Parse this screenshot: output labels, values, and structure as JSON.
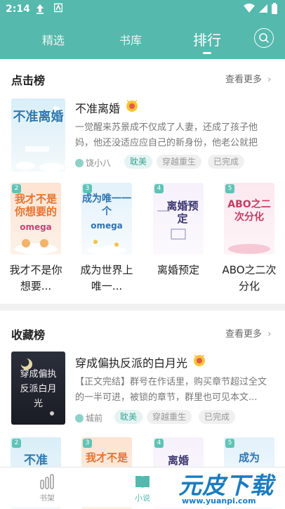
{
  "status": {
    "time": "2:14"
  },
  "nav": {
    "tabs": [
      {
        "label": "精选"
      },
      {
        "label": "书库"
      },
      {
        "label": "排行"
      }
    ]
  },
  "sections": [
    {
      "title": "点击榜",
      "more": "查看更多",
      "featured": {
        "title": "不准离婚",
        "desc": "一觉醒来苏景成不仅成了人妻，还成了孩子他妈，他还没适应应自己的新身份，他老公就把一...",
        "author": "饶小八",
        "tags": [
          "耽美",
          "穿越重生",
          "已完成"
        ],
        "cover_text": "不准离婚"
      },
      "grid": [
        {
          "rank": "2",
          "title": "我才不是你想要...",
          "cover_text": "我才不是你想要的",
          "cover_sub": "omega"
        },
        {
          "rank": "3",
          "title": "成为世界上唯一...",
          "cover_text": "成为唯一一个",
          "cover_sub": "omega"
        },
        {
          "rank": "4",
          "title": "离婚预定",
          "cover_text": "离婚预定",
          "cover_sub": ""
        },
        {
          "rank": "5",
          "title": "ABO之二次分化",
          "cover_text": "ABO之二次分化",
          "cover_sub": ""
        }
      ]
    },
    {
      "title": "收藏榜",
      "more": "查看更多",
      "featured": {
        "title": "穿成偏执反派的白月光",
        "desc": "【正文完结】群号在作话里，购买章节超过全文的一半可进，被锁的章节，群里也可见本文...",
        "author": "城前",
        "tags": [
          "耽美",
          "穿越重生",
          "已完成"
        ],
        "cover_text": "穿成偏执反派白月光"
      },
      "grid": [
        {
          "rank": "2",
          "cover_text": "不准"
        },
        {
          "rank": "3",
          "cover_text": "我才不是"
        },
        {
          "rank": "4",
          "cover_text": "离婚"
        },
        {
          "rank": "5",
          "cover_text": "成为"
        }
      ]
    }
  ],
  "bottom_nav": [
    {
      "label": "书架"
    },
    {
      "label": "小说"
    }
  ],
  "watermark": {
    "text": "元皮下载",
    "url": "www.yuanpi.com"
  },
  "colors": {
    "primary": "#55b9ad",
    "accent": "#39a596"
  }
}
